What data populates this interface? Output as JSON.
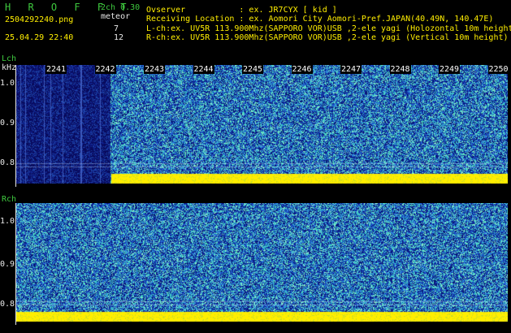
{
  "header": {
    "app_name": "H R O F F T",
    "version": "2ch 0.30",
    "filename": "2504292240.png",
    "datetime": "25.04.29 22:40",
    "meteor_label": "meteor",
    "meteor_l": "7",
    "meteor_r": "12",
    "observer": "Ovserver           : ex. JR7CYX [ kid ]",
    "location": "Receiving Location : ex. Aomori City Aomori-Pref.JAPAN(40.49N, 140.47E)",
    "lch_info": "L-ch:ex. UV5R 113.900Mhz(SAPPORO VOR)USB ,2-ele yagi (Holozontal 10m height)",
    "rch_info": "R-ch:ex. UV5R 113.900Mhz(SAPPORO VOR)USB ,2-ele yagi (Vertical 10m height)"
  },
  "lch": {
    "label": "Lch",
    "unit": "kHz",
    "ticks": [
      "1.0",
      "0.9",
      "0.8"
    ]
  },
  "rch": {
    "label": "Rch",
    "ticks": [
      "1.0",
      "0.9",
      "0.8"
    ]
  },
  "time_labels": [
    "2241",
    "2242",
    "2243",
    "2244",
    "2245",
    "2246",
    "2247",
    "2248",
    "2249",
    "2250"
  ],
  "colors": {
    "background": "#000000",
    "noise_low": "#0a1a8c",
    "noise_mid": "#2a6fd0",
    "noise_high": "#3fd0c0",
    "signal": "#ffee00",
    "label_green": "#3ec83e",
    "label_yellow": "#ffee00"
  }
}
